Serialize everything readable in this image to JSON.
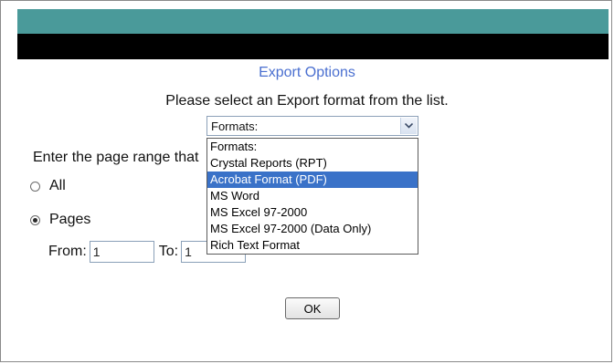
{
  "header": {
    "teal_color": "#4a9a9a",
    "black_color": "#000000"
  },
  "dialog": {
    "title": "Export Options",
    "instruction": "Please select an Export format from the list.",
    "format_select": {
      "current": "Formats:",
      "options": [
        "Formats:",
        "Crystal Reports (RPT)",
        "Acrobat Format (PDF)",
        "MS Word",
        "MS Excel 97-2000",
        "MS Excel 97-2000 (Data Only)",
        "Rich Text Format"
      ],
      "highlighted": "Acrobat Format (PDF)"
    },
    "page_range_label": "Enter the page range that",
    "radio_all_label": "All",
    "radio_pages_label": "Pages",
    "from_label": "From:",
    "from_value": "1",
    "to_label": "To:",
    "to_value": "1",
    "ok_label": "OK"
  }
}
